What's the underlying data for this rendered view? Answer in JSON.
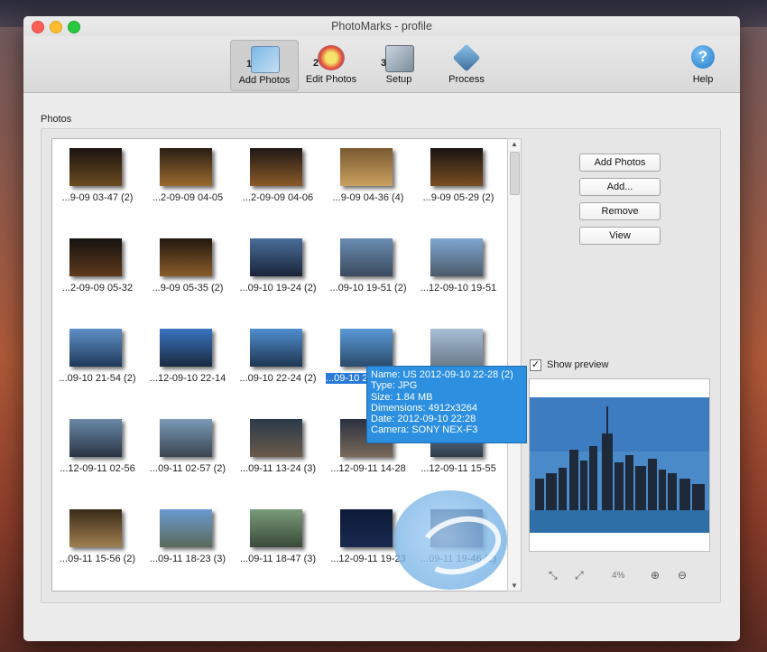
{
  "window": {
    "title": "PhotoMarks - profile"
  },
  "toolbar": {
    "items": [
      {
        "label": "Add Photos",
        "num": "1",
        "active": true
      },
      {
        "label": "Edit Photos",
        "num": "2"
      },
      {
        "label": "Setup",
        "num": "3"
      },
      {
        "label": "Process"
      }
    ],
    "help_label": "Help"
  },
  "photos": {
    "label": "Photos",
    "items": [
      "...9-09 03-47 (2)",
      "...2-09-09 04-05",
      "...2-09-09 04-06",
      "...9-09 04-36 (4)",
      "...9-09 05-29 (2)",
      "...2-09-09 05-32",
      "...9-09 05-35 (2)",
      "...09-10 19-24 (2)",
      "...09-10 19-51 (2)",
      "...12-09-10 19-51",
      "...09-10 21-54 (2)",
      "...12-09-10 22-14",
      "...09-10 22-24 (2)",
      "...09-10 2",
      "",
      "...12-09-11 02-56",
      "...09-11 02-57 (2)",
      "...09-11 13-24 (3)",
      "...12-09-11 14-28",
      "...12-09-11 15-55",
      "...09-11 15-56 (2)",
      "...09-11 18-23 (3)",
      "...09-11 18-47 (3)",
      "...12-09-11 19-23",
      "...09-11 19-46 (2)"
    ]
  },
  "buttons": {
    "add_photos": "Add Photos",
    "add": "Add...",
    "remove": "Remove",
    "view": "View"
  },
  "preview": {
    "show_label": "Show preview",
    "checked": true,
    "zoom": "4%"
  },
  "tooltip": {
    "name": "Name: US 2012-09-10 22-28 (2)",
    "type": "Type: JPG",
    "size": "Size: 1.84 MB",
    "dimensions": "Dimensions: 4912x3264",
    "date": "Date: 2012-09-10 22:28",
    "camera": "Camera: SONY NEX-F3"
  },
  "colors": {
    "accent": "#2a7bd8",
    "tooltip": "#2c8fe0"
  }
}
